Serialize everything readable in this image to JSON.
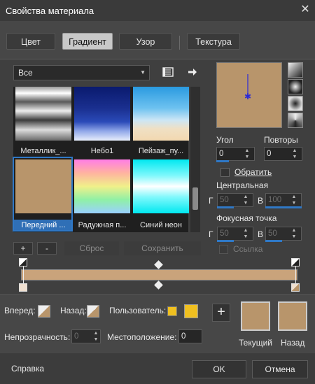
{
  "window": {
    "title": "Свойства материала",
    "close_glyph": "✕"
  },
  "tabs": [
    {
      "label": "Цвет",
      "active": false
    },
    {
      "label": "Градиент",
      "active": true
    },
    {
      "label": "Узор",
      "active": false
    },
    {
      "label": "Текстура",
      "active": false
    }
  ],
  "library": {
    "category": "Все",
    "menu_icon": "book-icon",
    "forward_icon": "arrow-right-icon",
    "presets": [
      {
        "label": "Металлик_...",
        "selected": false
      },
      {
        "label": "Небо1",
        "selected": false
      },
      {
        "label": "Пейзаж_пу...",
        "selected": false
      },
      {
        "label": "Передний ...",
        "selected": true
      },
      {
        "label": "Радужная п...",
        "selected": false
      },
      {
        "label": "Синий неон",
        "selected": false
      }
    ],
    "buttons": {
      "add": "+",
      "remove": "-",
      "reset": "Сброс",
      "save": "Сохранить"
    }
  },
  "properties": {
    "angle_label": "Угол",
    "angle_value": "0",
    "repeats_label": "Повторы",
    "repeats_value": "0",
    "invert_label": "Обратить",
    "center_label": "Центральная",
    "center_h_prefix": "Г",
    "center_h_value": "50",
    "center_v_prefix": "В",
    "center_v_value": "100",
    "focus_label": "Фокусная точка",
    "focus_h_prefix": "Г",
    "focus_h_value": "50",
    "focus_v_prefix": "В",
    "focus_v_value": "50",
    "link_label": "Ссылка"
  },
  "stops": {
    "forward_label": "Вперед:",
    "back_label": "Назад:",
    "user_label": "Пользователь:",
    "opacity_label": "Непрозрачность:",
    "opacity_value": "0",
    "location_label": "Местоположение:",
    "location_value": "0"
  },
  "current": {
    "add_glyph": "+",
    "current_label": "Текущий",
    "back_label": "Назад"
  },
  "footer": {
    "help_label": "Справка",
    "ok_label": "OK",
    "cancel_label": "Отмена"
  },
  "colors": {
    "gradient_tan": "#c9a37b",
    "swatch_tan": "#b8956b",
    "user_gold": "#f0c020",
    "accent_blue": "#2f78c6",
    "gradient_preview_bg": "#b8956b"
  }
}
